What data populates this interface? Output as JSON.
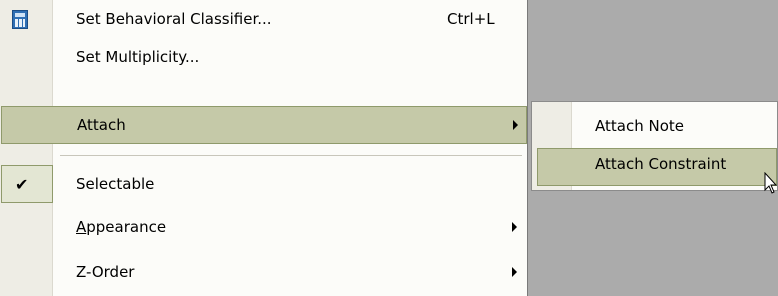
{
  "menu": {
    "items": [
      {
        "label": "Set Behavioral Classifier...",
        "shortcut": "Ctrl+L",
        "icon": "calculator-icon"
      },
      {
        "label": "Set Multiplicity..."
      },
      {
        "label": "Attach",
        "has_submenu": true,
        "highlighted": true
      },
      {
        "label": "Selectable",
        "checked": true
      },
      {
        "label": "Appearance",
        "has_submenu": true,
        "mnemonic": "A"
      },
      {
        "label": "Z-Order",
        "has_submenu": true
      }
    ]
  },
  "submenu": {
    "items": [
      {
        "label": "Attach Note"
      },
      {
        "label": "Attach Constraint",
        "highlighted": true
      }
    ]
  },
  "colors": {
    "highlight": "#c5c9a8",
    "gutter": "#eeede5",
    "menu_background": "#fcfcf9",
    "desktop": "#ababab"
  }
}
